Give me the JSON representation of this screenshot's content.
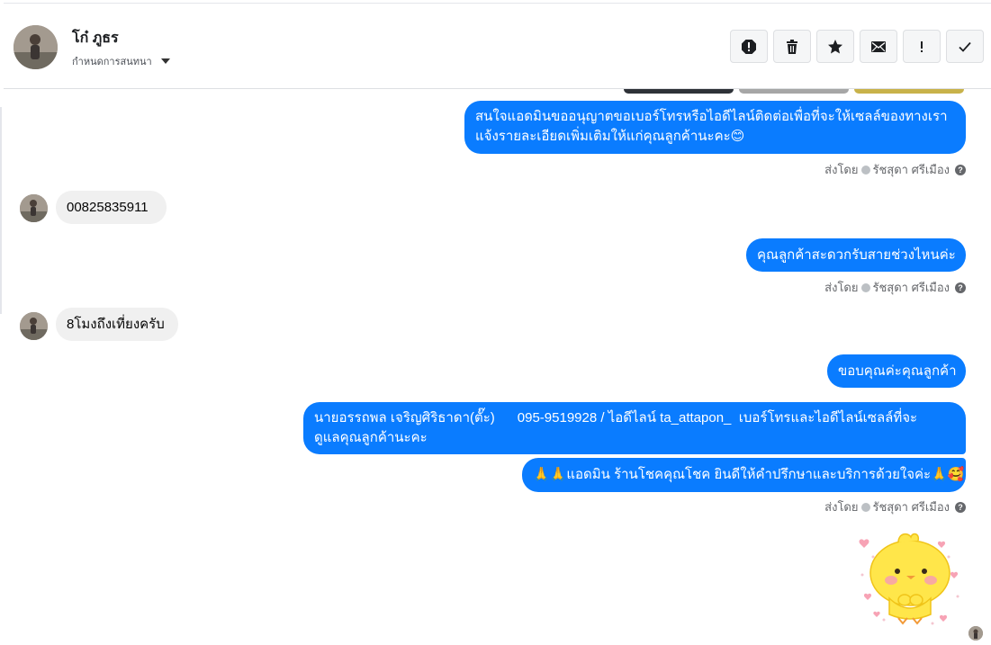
{
  "header": {
    "contact_name": "โก๋ ภูธร",
    "assign_label": "กำหนดการสนทนา",
    "actions": [
      "report-icon",
      "trash-icon",
      "star-icon",
      "envelope-icon",
      "exclamation-icon",
      "check-icon"
    ]
  },
  "messages": {
    "m1_line1": "สนใจแอดมินขออนุญาตขอเบอร์โทรหรือไอดีไลน์ติดต่อเพื่อที่จะให้เซลล์ของทางเรา",
    "m1_line2": "แจ้งรายละเอียดเพิ่มเติมให้แก่คุณลูกค้านะคะ😊",
    "m2": "00825835911",
    "m3": "คุณลูกค้าสะดวกรับสายช่วงไหนค่ะ",
    "m4": "8โมงถึงเที่ยงครับ",
    "m5": "ขอบคุณค่ะคุณลูกค้า",
    "m6_line1": "นายอรรถพล เจริญศิริธาดา(ตั๊ะ)      095-9519928 / ไอดีไลน์ ta_attapon_  เบอร์โทรและไอดีไลน์เซลล์ที่จะ",
    "m6_line2": "ดูแลคุณลูกค้านะคะ",
    "m7": "🙏🙏แอดมิน ร้านโชคคุณโชค ยินดีให้คำปรึกษาและบริการด้วยใจค่ะ🙏🥰"
  },
  "meta": {
    "sent_by": "ส่งโดย",
    "agent": "รัชสุดา ศรีเมือง",
    "help": "?"
  },
  "colors": {
    "outgoing": "#0a7cff",
    "incoming": "#f0f0f0"
  }
}
